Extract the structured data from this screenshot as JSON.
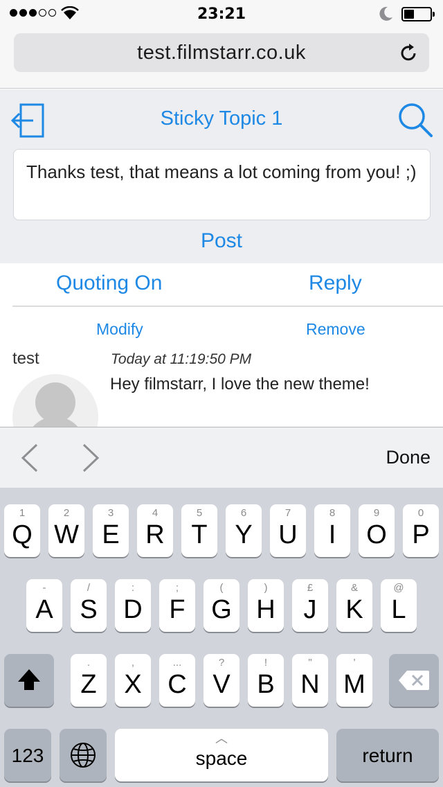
{
  "status_bar": {
    "time": "23:21",
    "signal_bars_filled": 3,
    "signal_bars_total": 5,
    "battery_level": 0.3
  },
  "browser": {
    "url": "test.filmstarr.co.uk",
    "icons": {
      "reload": "reload-icon"
    }
  },
  "header": {
    "title": "Sticky Topic 1",
    "icons": {
      "back": "logout-icon",
      "search": "search-icon"
    }
  },
  "reply_box": {
    "text": "Thanks test, that means a lot coming from you! ;)"
  },
  "post_button": "Post",
  "actions": {
    "quoting": "Quoting On",
    "reply": "Reply"
  },
  "post": {
    "modify": "Modify",
    "remove": "Remove",
    "author": "test",
    "timestamp": "Today at 11:19:50 PM",
    "message": "Hey filmstarr, I love the new theme!"
  },
  "accessory_bar": {
    "done": "Done",
    "icons": {
      "prev": "chevron-left-icon",
      "next": "chevron-right-icon"
    }
  },
  "keyboard": {
    "row1": [
      {
        "key": "Q",
        "hint": "1"
      },
      {
        "key": "W",
        "hint": "2"
      },
      {
        "key": "E",
        "hint": "3"
      },
      {
        "key": "R",
        "hint": "4"
      },
      {
        "key": "T",
        "hint": "5"
      },
      {
        "key": "Y",
        "hint": "6"
      },
      {
        "key": "U",
        "hint": "7"
      },
      {
        "key": "I",
        "hint": "8"
      },
      {
        "key": "O",
        "hint": "9"
      },
      {
        "key": "P",
        "hint": "0"
      }
    ],
    "row2": [
      {
        "key": "A",
        "hint": "-"
      },
      {
        "key": "S",
        "hint": "/"
      },
      {
        "key": "D",
        "hint": ":"
      },
      {
        "key": "F",
        "hint": ";"
      },
      {
        "key": "G",
        "hint": "("
      },
      {
        "key": "H",
        "hint": ")"
      },
      {
        "key": "J",
        "hint": "£"
      },
      {
        "key": "K",
        "hint": "&"
      },
      {
        "key": "L",
        "hint": "@"
      }
    ],
    "row3": [
      {
        "key": "Z",
        "hint": "."
      },
      {
        "key": "X",
        "hint": ","
      },
      {
        "key": "C",
        "hint": "..."
      },
      {
        "key": "V",
        "hint": "?"
      },
      {
        "key": "B",
        "hint": "!"
      },
      {
        "key": "N",
        "hint": "\""
      },
      {
        "key": "M",
        "hint": "'"
      }
    ],
    "numbers": "123",
    "space": "space",
    "return": "return",
    "icons": {
      "shift": "shift-icon",
      "delete": "delete-icon",
      "globe": "globe-icon"
    }
  }
}
